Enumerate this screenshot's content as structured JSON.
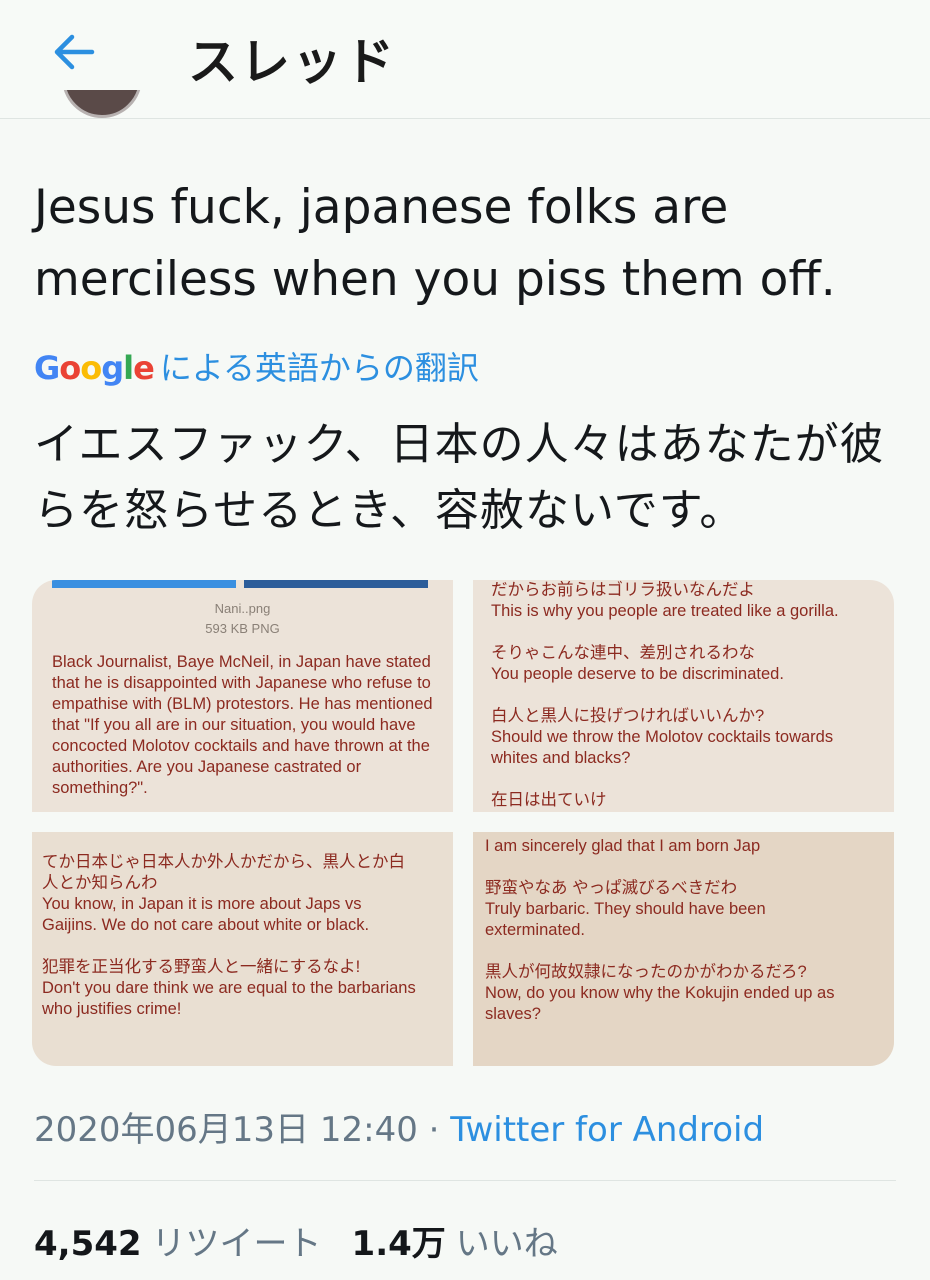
{
  "header": {
    "title": "スレッド"
  },
  "tweet": {
    "text": "Jesus fuck, japanese folks are merciless when you piss them off.",
    "translation_label": "による英語からの翻訳",
    "translation_provider": "Google",
    "translated_text": "イエスファック、日本の人々はあなたが彼らを怒らせるとき、容赦ないです。"
  },
  "media": {
    "tile1": {
      "file_name": "Nani..png",
      "file_size": "593 KB PNG",
      "body": "Black Journalist, Baye McNeil, in Japan have stated that he is disappointed with Japanese who refuse to empathise with (BLM) protestors. He has mentioned that \"If you all are in our situation, you would have concocted Molotov cocktails and have thrown at the authorities. Are you Japanese castrated or something?\"."
    },
    "tile2": {
      "lines": [
        "だからお前らはゴリラ扱いなんだよ",
        "This is why you people are treated like a gorilla.",
        "",
        "そりゃこんな連中、差別されるわな",
        "You people deserve to be discriminated.",
        "",
        "白人と黒人に投げつければいいんか?",
        "Should we throw the Molotov cocktails towards",
        "whites and blacks?",
        ""
      ],
      "cut_line": "在日は出ていけ"
    },
    "tile3": {
      "lines": [
        "てか日本じゃ日本人か外人かだから、黒人とか白",
        "人とか知らんわ",
        "You know, in Japan it is more about Japs vs",
        "Gaijins. We do not care about white or black.",
        "",
        "犯罪を正当化する野蛮人と一緒にするなよ!",
        "Don't you dare think we are equal to the barbarians",
        "who justifies crime!"
      ]
    },
    "tile4": {
      "lines": [
        "I am sincerely glad that I am born Jap",
        "",
        "野蛮やなあ やっぱ滅びるべきだわ",
        "Truly barbaric. They should have been",
        "exterminated.",
        "",
        "黒人が何故奴隷になったのかがわかるだろ?",
        "Now, do you know why the Kokujin ended up as",
        "slaves?"
      ]
    }
  },
  "meta": {
    "timestamp": "2020年06月13日 12:40",
    "separator": " · ",
    "source": "Twitter for Android"
  },
  "stats": {
    "retweets_count": "4,542",
    "retweets_label": "リツイート",
    "likes_count": "1.4万",
    "likes_label": "いいね"
  },
  "colors": {
    "accent": "#2c8fe0",
    "meme_text": "#8c2a20",
    "meme_bg": "#ece3d9"
  },
  "icons": {
    "back": "arrow-left-icon"
  }
}
